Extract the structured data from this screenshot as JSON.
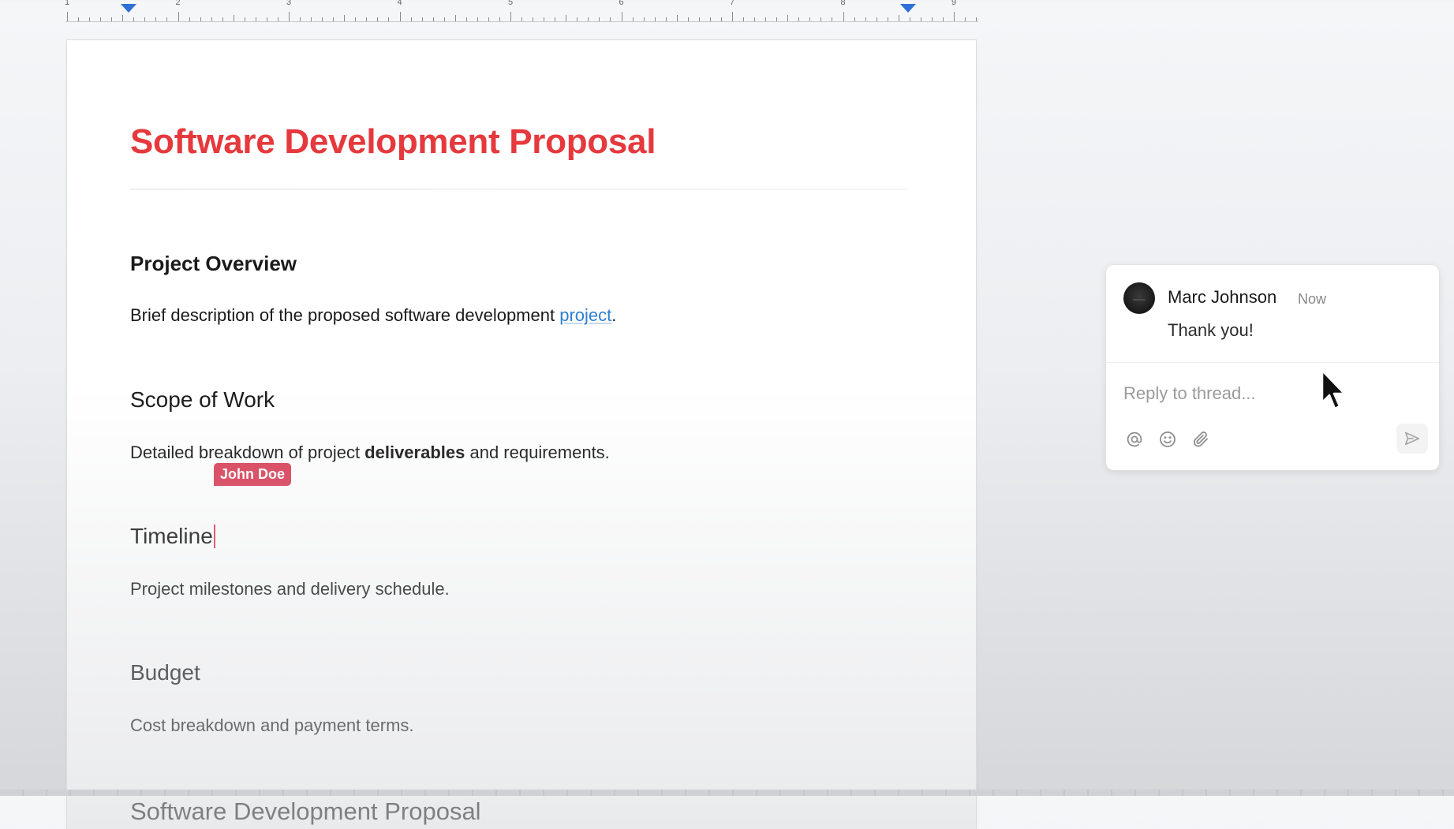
{
  "ruler": {
    "numbers": [
      "1",
      "2",
      "3",
      "4",
      "5",
      "6",
      "7",
      "8",
      "9"
    ]
  },
  "document": {
    "title": "Software Development Proposal",
    "sections": {
      "overview": {
        "heading": "Project Overview",
        "text_before_link": "Brief description of the proposed software development ",
        "link_text": "project",
        "text_after_link": "."
      },
      "scope": {
        "heading": "Scope of Work",
        "text_before_bold": "Detailed breakdown of project ",
        "bold_text": "deliverables",
        "text_after_bold": " and requirements."
      },
      "timeline": {
        "heading": "Timeline",
        "text": "Project milestones and delivery schedule."
      },
      "budget": {
        "heading": "Budget",
        "text": "Cost breakdown and payment terms."
      },
      "repeat_heading": "Software Development Proposal"
    },
    "collaborator_cursor": {
      "name": "John Doe",
      "color": "#d9435b"
    }
  },
  "comment_thread": {
    "author": "Marc Johnson",
    "time": "Now",
    "body": "Thank you!",
    "reply_placeholder": "Reply to thread...",
    "tools": [
      "mention-icon",
      "emoji-icon",
      "attachment-icon"
    ],
    "send_icon": "send-icon"
  },
  "colors": {
    "title": "#e5393d",
    "link": "#2f7fd1",
    "ruler_marker": "#2f6fd6",
    "cursor_tag": "#d9435b"
  }
}
